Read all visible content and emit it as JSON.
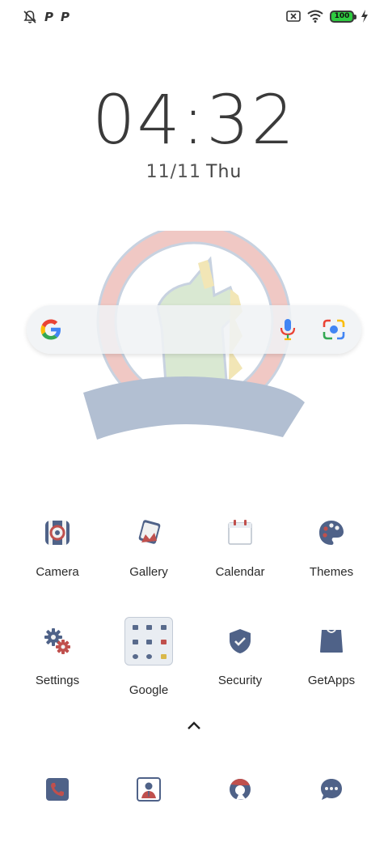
{
  "status_bar": {
    "left_icons": [
      "notifications-off-icon",
      "parking-icon",
      "parking-icon"
    ],
    "p1": "P",
    "p2": "P",
    "right_icons": [
      "sim-off-icon",
      "wifi-icon",
      "battery-icon",
      "charging-icon"
    ],
    "battery": "100"
  },
  "lockclock": {
    "time": "04:32",
    "date": "11/11",
    "weekday": "Thu"
  },
  "search": {
    "icons": [
      "google-g-icon",
      "mic-icon",
      "lens-icon"
    ]
  },
  "apps": [
    {
      "label": "Camera",
      "icon": "camera-icon"
    },
    {
      "label": "Gallery",
      "icon": "gallery-icon"
    },
    {
      "label": "Calendar",
      "icon": "calendar-icon"
    },
    {
      "label": "Themes",
      "icon": "palette-icon"
    },
    {
      "label": "Settings",
      "icon": "gear-icon"
    },
    {
      "label": "Google",
      "icon": "folder-icon"
    },
    {
      "label": "Security",
      "icon": "shield-icon"
    },
    {
      "label": "GetApps",
      "icon": "shopping-bag-icon"
    }
  ],
  "dock": [
    {
      "icon": "phone-icon"
    },
    {
      "icon": "contacts-icon"
    },
    {
      "icon": "browser-icon"
    },
    {
      "icon": "messages-icon"
    }
  ],
  "colors": {
    "icon_blue": "#4f6288",
    "icon_red": "#c0504d",
    "battery_green": "#2ecc40"
  }
}
